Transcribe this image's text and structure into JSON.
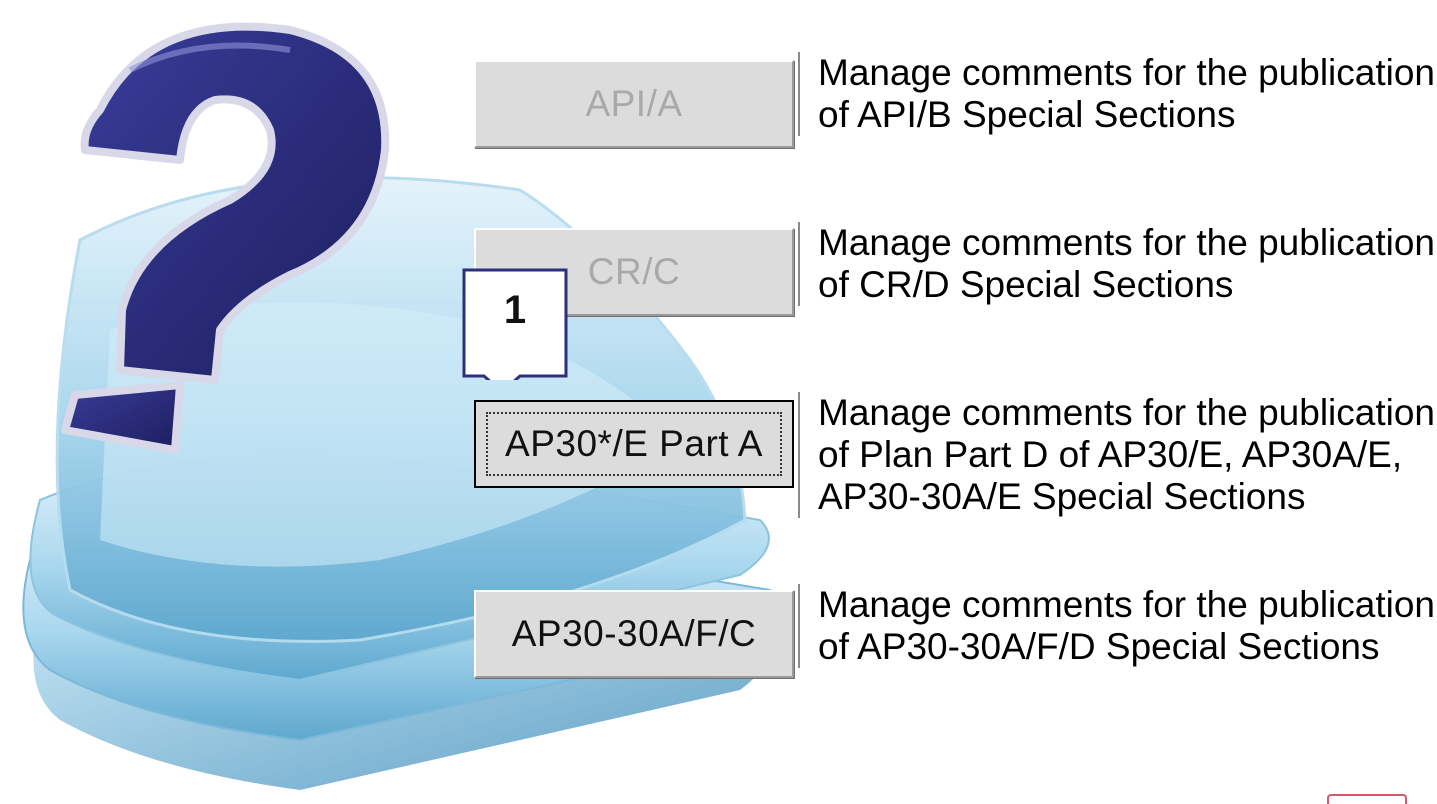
{
  "buttons": [
    {
      "label": "API/A",
      "state": "disabled"
    },
    {
      "label": "CR/C",
      "state": "disabled"
    },
    {
      "label": "AP30*/E Part A",
      "state": "focused"
    },
    {
      "label": "AP30-30A/F/C",
      "state": "enabled"
    }
  ],
  "descriptions": [
    {
      "lines": [
        "Manage comments for the publication",
        "of API/B Special Sections"
      ]
    },
    {
      "lines": [
        "Manage comments for the publication",
        "of CR/D Special Sections"
      ]
    },
    {
      "lines": [
        "Manage comments for the publication",
        "of Plan Part D of AP30/E, AP30A/E,",
        "AP30-30A/E Special Sections"
      ]
    },
    {
      "lines": [
        "Manage comments for the publication",
        "of AP30-30A/F/D Special Sections"
      ]
    }
  ],
  "callout": {
    "number": "1",
    "color": "#2d2f7a"
  },
  "graphic": {
    "icon": "question-mark-icon",
    "base": "stacked-layers-icon",
    "question_color": "#2a2a7e",
    "layer_color": "#9fd0ea"
  }
}
